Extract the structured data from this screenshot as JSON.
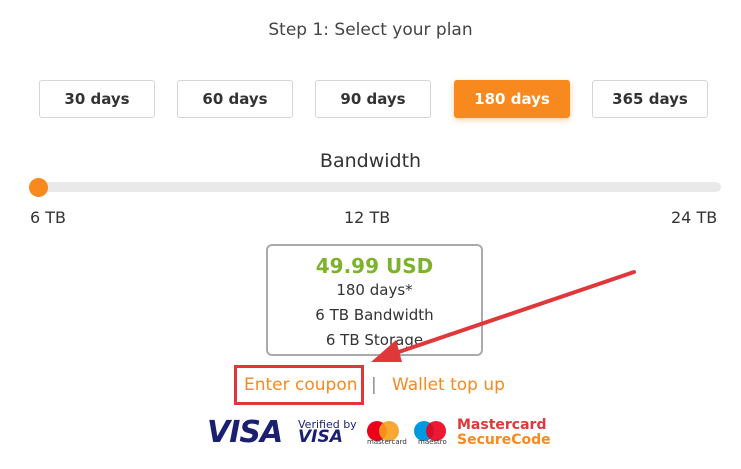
{
  "step_title": "Step 1: Select your plan",
  "plans": [
    {
      "label": "30 days",
      "active": false
    },
    {
      "label": "60 days",
      "active": false
    },
    {
      "label": "90 days",
      "active": false
    },
    {
      "label": "180 days",
      "active": true
    },
    {
      "label": "365 days",
      "active": false
    }
  ],
  "bandwidth": {
    "title": "Bandwidth",
    "ticks": [
      "6 TB",
      "12 TB",
      "24 TB"
    ],
    "selected": "6 TB"
  },
  "summary": {
    "price": "49.99 USD",
    "duration": "180 days*",
    "bandwidth": "6 TB Bandwidth",
    "storage": "6 TB Storage"
  },
  "links": {
    "coupon": "Enter coupon",
    "separator": "|",
    "wallet": "Wallet top up"
  },
  "payment": {
    "visa": "VISA",
    "vbv_line1": "Verified by",
    "vbv_line2": "VISA",
    "mastercard_caption": "mastercard",
    "maestro_caption": "maestro",
    "mcsc_line1": "Mastercard",
    "mcsc_line2": "SecureCode"
  },
  "colors": {
    "accent": "#f7891f",
    "price": "#7cb32a",
    "highlight": "#e0383a"
  }
}
